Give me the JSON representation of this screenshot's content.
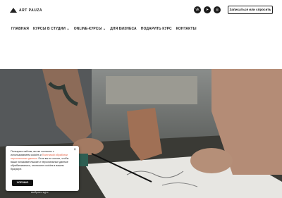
{
  "header": {
    "logo_text": "ART PAUZA",
    "socials": [
      {
        "icon": "vk-icon",
        "glyph": "vk"
      },
      {
        "icon": "telegram-icon",
        "glyph": "➤"
      },
      {
        "icon": "instagram-icon",
        "glyph": "◎"
      }
    ],
    "cta_label": "Записаться или спросить"
  },
  "nav": {
    "items": [
      {
        "label": "ГЛАВНАЯ"
      },
      {
        "label": "КУРСЫ В СТУДИИ ⌄"
      },
      {
        "label": "ONLINE-КУРСЫ ⌄"
      },
      {
        "label": "ДЛЯ БИЗНЕСА"
      },
      {
        "label": "ПОДАРИТЬ КУРС"
      },
      {
        "label": "КОНТАКТЫ"
      }
    ]
  },
  "cookie": {
    "text_before": "Пользуясь сайтом, вы же согласны с использованием cookies и ",
    "link_text": "Политикой обработки персональных данных",
    "text_after": ". Если вы не хотите, чтобы ваши пользовательские и персональные данные обрабатывались, отключите cookies в вашем браузере.",
    "close_glyph": "×",
    "ok_label": "ХОРОШО"
  },
  "hero": {
    "caption": "выбрать курс"
  }
}
